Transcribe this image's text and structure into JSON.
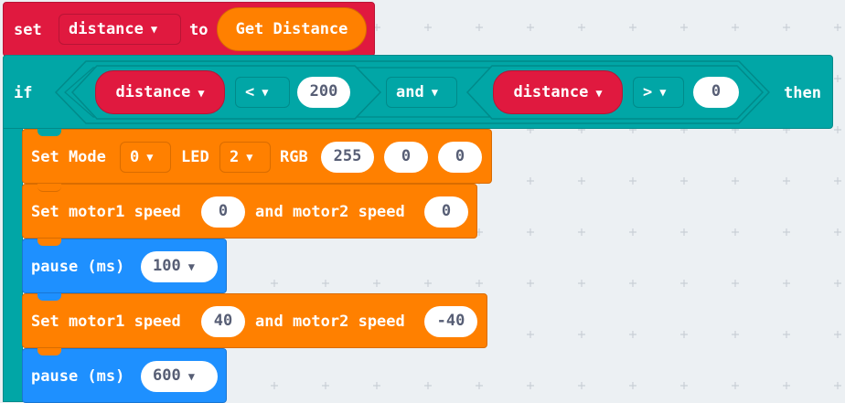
{
  "set_block": {
    "keyword_set": "set",
    "variable": "distance",
    "keyword_to": "to",
    "value_block": "Get Distance"
  },
  "if_block": {
    "keyword_if": "if",
    "keyword_then": "then",
    "left_compare": {
      "variable": "distance",
      "operator": "<",
      "value": "200"
    },
    "logic_operator": "and",
    "right_compare": {
      "variable": "distance",
      "operator": ">",
      "value": "0"
    }
  },
  "set_mode_block": {
    "label": "Set Mode",
    "mode": "0",
    "led_label": "LED",
    "led": "2",
    "rgb_label": "RGB",
    "r": "255",
    "g": "0",
    "b": "0"
  },
  "motor_block_1": {
    "label1": "Set motor1 speed",
    "speed1": "0",
    "label2": "and motor2 speed",
    "speed2": "0"
  },
  "pause_block_1": {
    "label": "pause (ms)",
    "value": "100"
  },
  "motor_block_2": {
    "label1": "Set motor1 speed",
    "speed1": "40",
    "label2": "and motor2 speed",
    "speed2": "-40"
  },
  "pause_block_2": {
    "label": "pause (ms)",
    "value": "600"
  },
  "colors": {
    "variables": "#e0193f",
    "logic": "#01a6a6",
    "robot": "#ff8000",
    "basic": "#1e90ff",
    "workspace": "#ecf0f3"
  }
}
